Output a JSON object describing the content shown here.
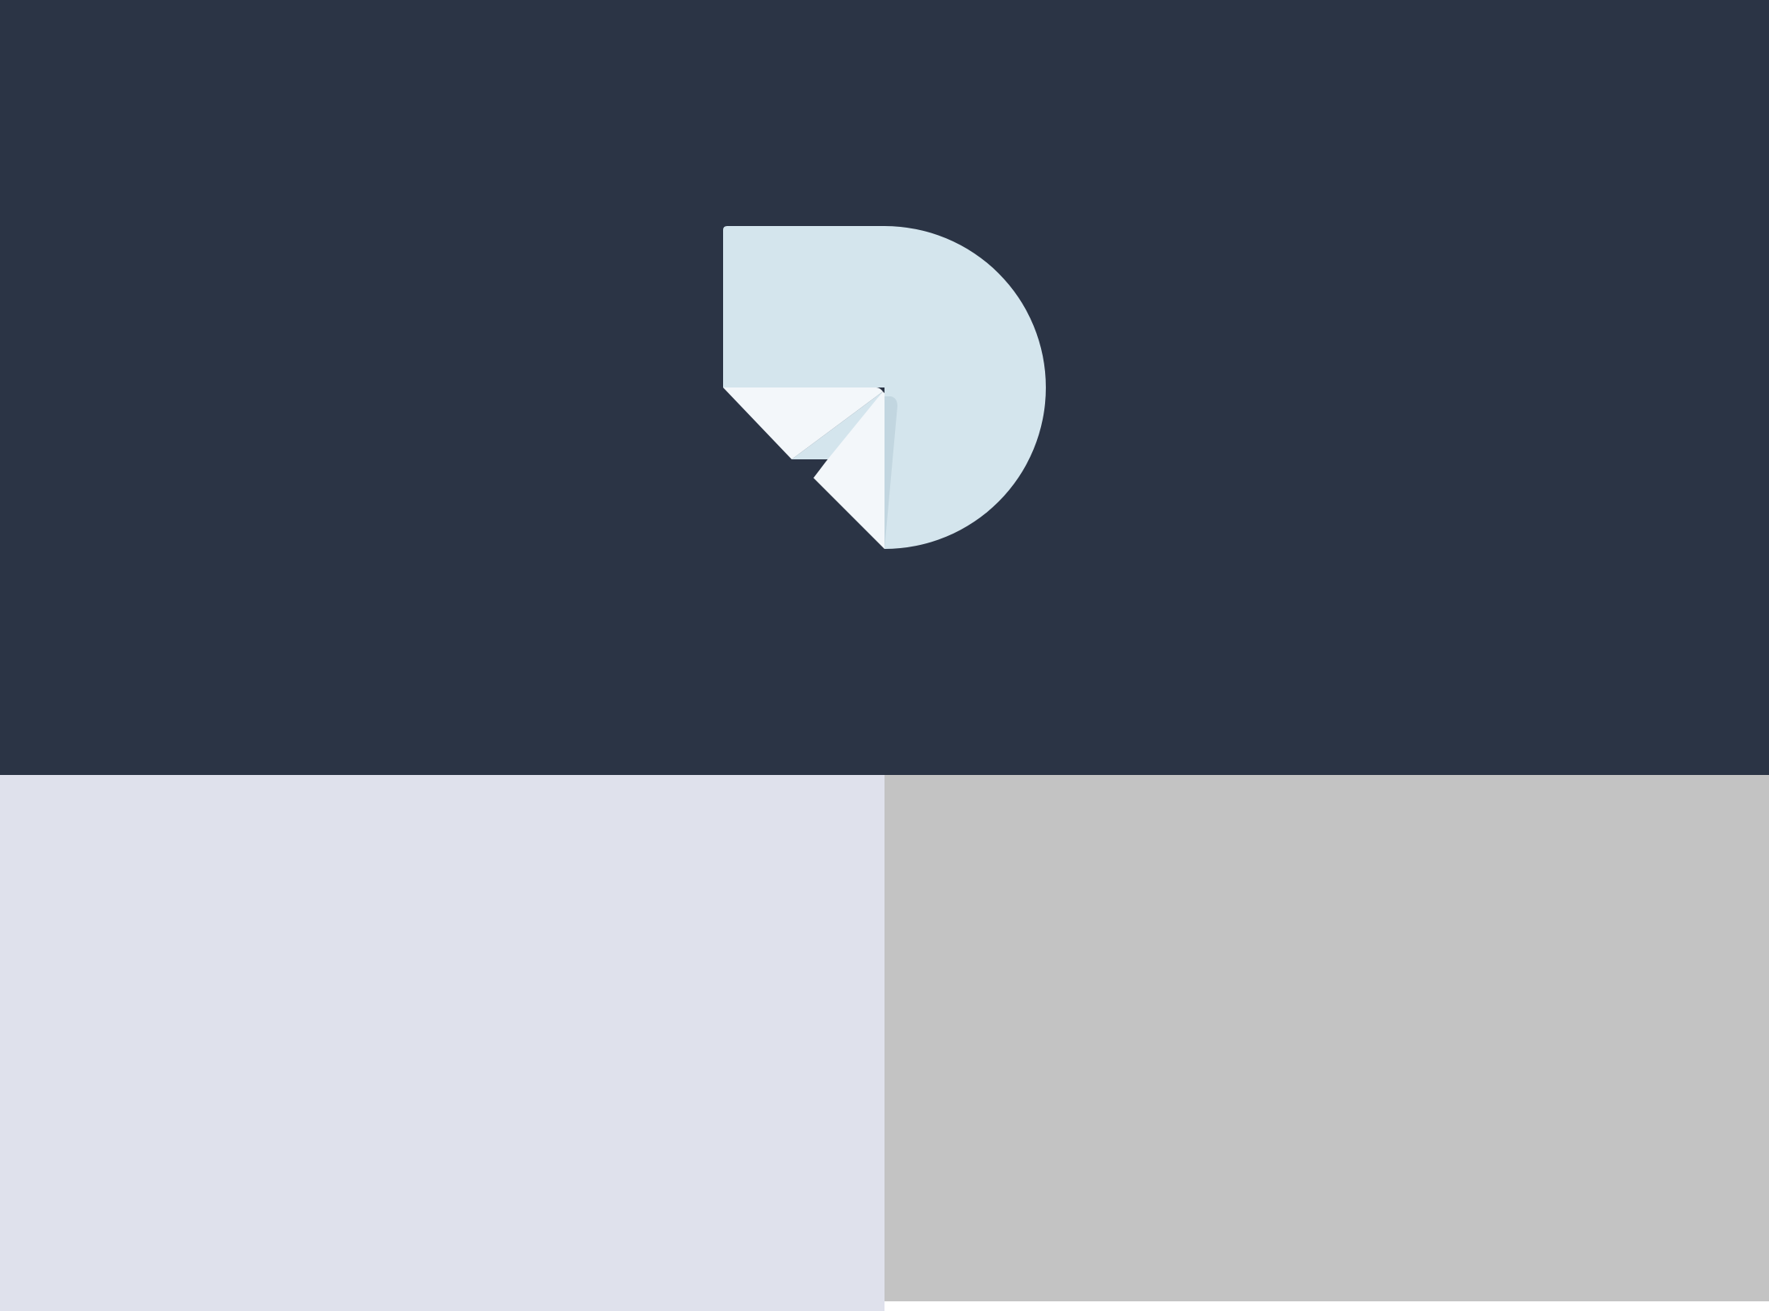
{
  "colors": {
    "hero_background": "#2b3445",
    "logo_primary": "#d4e5ed",
    "logo_highlight": "#f3f7fa",
    "logo_shadow": "#c2d6e0",
    "left_panel": "#dfe1ec",
    "right_panel": "#c3c3c3"
  },
  "logo": {
    "icon": "folded-d-logo-icon"
  }
}
